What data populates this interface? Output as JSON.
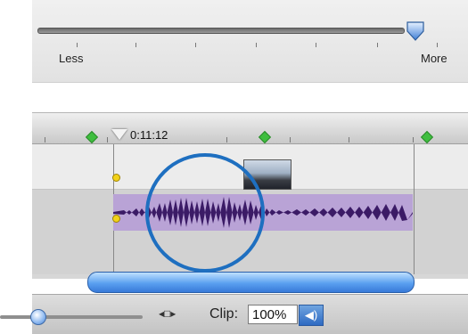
{
  "slider": {
    "min_label": "Less",
    "max_label": "More",
    "value_fraction": 0.95
  },
  "timeline": {
    "timecode": "0:11:12"
  },
  "controls": {
    "clip_label": "Clip:",
    "clip_volume": "100%"
  },
  "icons": {
    "speaker": "speaker-icon",
    "fit": "fit-icon",
    "playhead": "playhead-icon"
  },
  "colors": {
    "accent": "#1e6fc0",
    "waveform": "#3b1b66",
    "clip_bg": "#b9a3d6"
  }
}
